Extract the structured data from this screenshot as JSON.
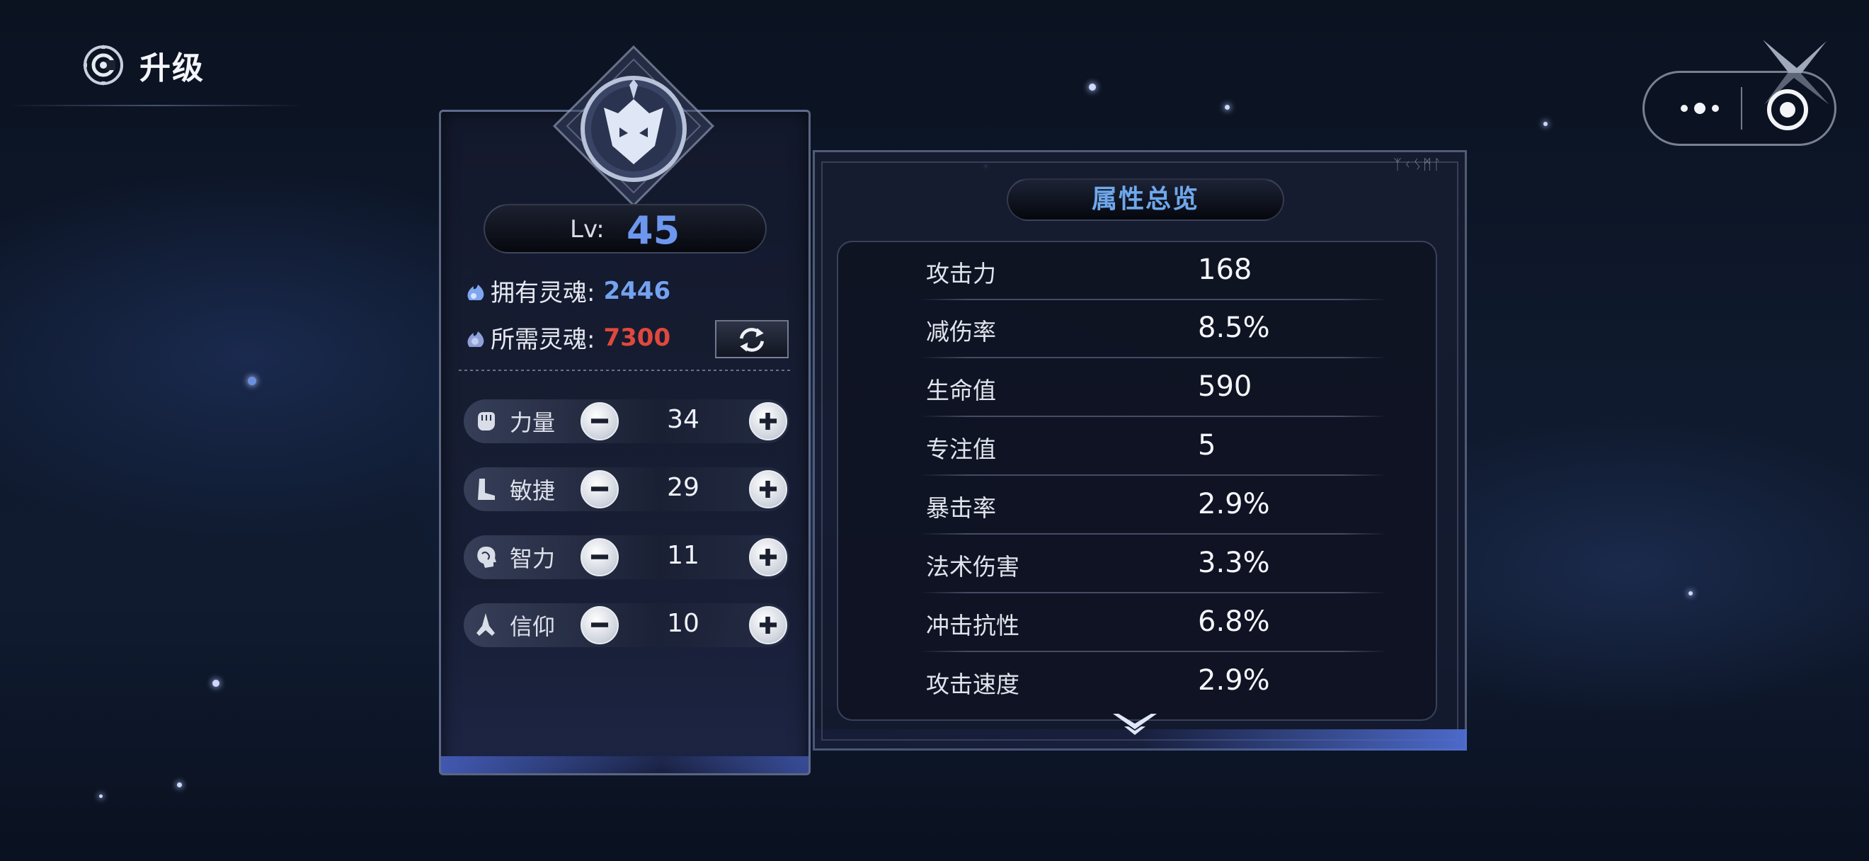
{
  "header": {
    "title": "升级",
    "icon": "upgrade-emblem-icon"
  },
  "capsule": {
    "more_icon": "more-dots-icon",
    "close_icon": "target-close-icon"
  },
  "level": {
    "label": "Lv:",
    "value": "45"
  },
  "souls": {
    "own_label": "拥有灵魂:",
    "own_value": "2446",
    "need_label": "所需灵魂:",
    "need_value": "7300",
    "own_color": "#74a2f0",
    "need_color": "#e0483e"
  },
  "attributes": [
    {
      "icon": "fist-icon",
      "label": "力量",
      "value": "34"
    },
    {
      "icon": "boot-icon",
      "label": "敏捷",
      "value": "29"
    },
    {
      "icon": "head-brain-icon",
      "label": "智力",
      "value": "11"
    },
    {
      "icon": "praying-hands-icon",
      "label": "信仰",
      "value": "10"
    }
  ],
  "overview": {
    "title": "属性总览",
    "stats": [
      {
        "label": "攻击力",
        "value": "168"
      },
      {
        "label": "减伤率",
        "value": "8.5%"
      },
      {
        "label": "生命值",
        "value": "590"
      },
      {
        "label": "专注值",
        "value": "5"
      },
      {
        "label": "暴击率",
        "value": "2.9%"
      },
      {
        "label": "法术伤害",
        "value": "3.3%"
      },
      {
        "label": "冲击抗性",
        "value": "6.8%"
      },
      {
        "label": "攻击速度",
        "value": "2.9%"
      }
    ]
  },
  "colors": {
    "accent_blue": "#6d97ee",
    "title_blue": "#6fa8ec",
    "warning_red": "#e0483e"
  }
}
